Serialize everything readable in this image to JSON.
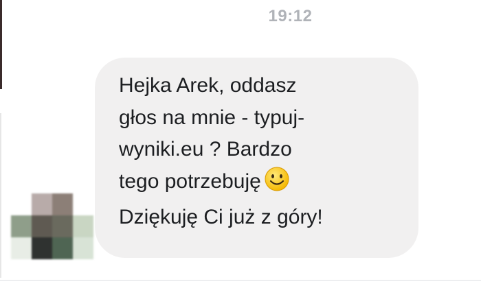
{
  "conversation": {
    "timestamp": "19:12",
    "message": {
      "lines": [
        "Hejka Arek, oddasz",
        "głos na mnie - typuj-",
        "wyniki.eu ? Bardzo",
        "tego potrzebuję",
        "Dziękuję Ci już z góry!"
      ],
      "emoji": "smiling-face-emoji"
    },
    "avatar": {
      "icon": "avatar-pixelated",
      "colors": [
        "#ffffff",
        "#b8aba9",
        "#8c7f77",
        "#ffffff",
        "#8f9e8a",
        "#5f5a52",
        "#6a6a5e",
        "#c9d6c3",
        "#e8ede6",
        "#2f3230",
        "#4f6553",
        "#d8e3d6"
      ]
    }
  },
  "colors": {
    "bubble": "#f1f0f0",
    "text": "#1c1e21",
    "timestamp": "#b0b3b8"
  }
}
